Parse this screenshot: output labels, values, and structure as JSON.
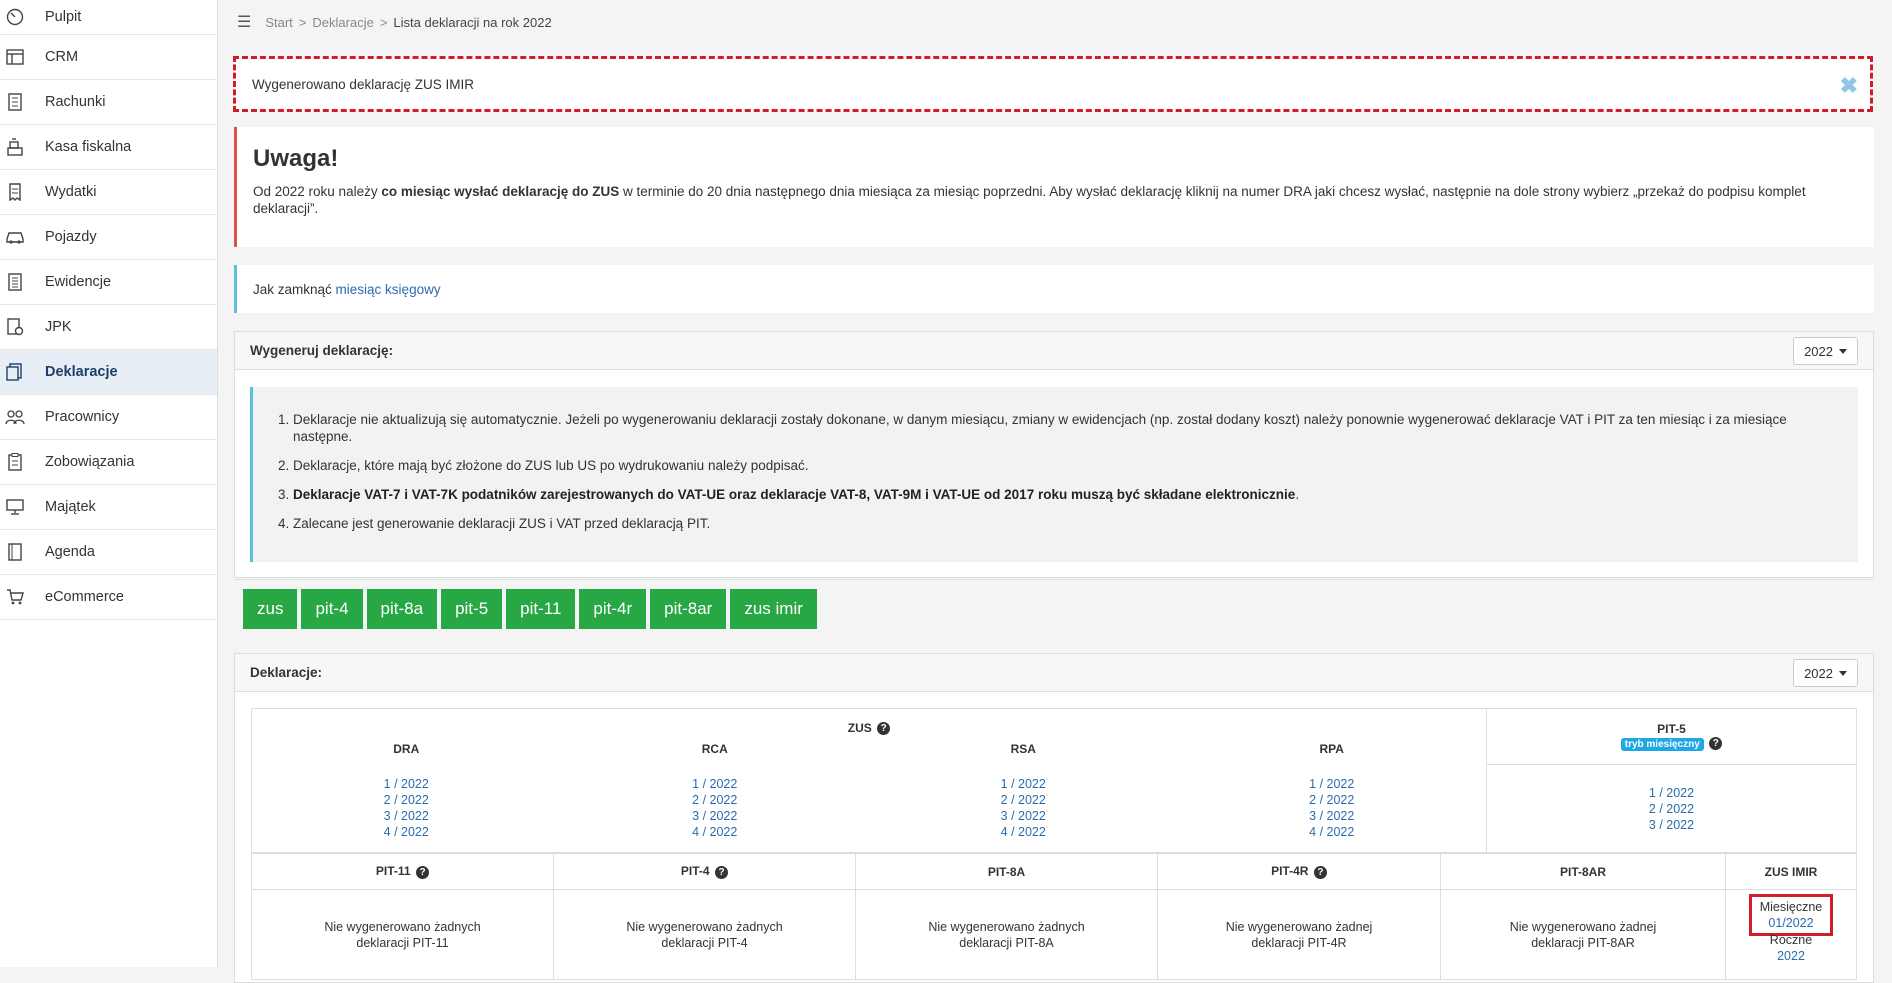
{
  "sidebar": {
    "items": [
      {
        "label": "Pulpit",
        "icon": "gauge-icon"
      },
      {
        "label": "CRM",
        "icon": "crm-window-icon"
      },
      {
        "label": "Rachunki",
        "icon": "invoice-icon"
      },
      {
        "label": "Kasa fiskalna",
        "icon": "cash-register-icon"
      },
      {
        "label": "Wydatki",
        "icon": "expenses-icon"
      },
      {
        "label": "Pojazdy",
        "icon": "car-icon"
      },
      {
        "label": "Ewidencje",
        "icon": "register-book-icon"
      },
      {
        "label": "JPK",
        "icon": "jpk-file-icon"
      },
      {
        "label": "Deklaracje",
        "icon": "declarations-icon"
      },
      {
        "label": "Pracownicy",
        "icon": "employees-icon"
      },
      {
        "label": "Zobowiązania",
        "icon": "obligations-icon"
      },
      {
        "label": "Majątek",
        "icon": "monitor-icon"
      },
      {
        "label": "Agenda",
        "icon": "agenda-icon"
      },
      {
        "label": "eCommerce",
        "icon": "cart-icon"
      }
    ]
  },
  "breadcrumb": {
    "start": "Start",
    "sep": ">",
    "section": "Deklaracje",
    "current": "Lista deklaracji na rok 2022"
  },
  "alert": {
    "text": "Wygenerowano deklarację ZUS IMIR",
    "close": "✖"
  },
  "warning": {
    "title": "Uwaga!",
    "p1": "Od 2022 roku należy ",
    "p_bold": "co miesiąc wysłać deklarację do ZUS",
    "p2": " w terminie do 20 dnia następnego dnia miesiąca za miesiąc poprzedni. Aby wysłać deklarację kliknij na numer DRA jaki chcesz wysłać, następnie na dole strony wybierz „przekaż do podpisu komplet deklaracji”."
  },
  "info": {
    "text": "Jak zamknąć ",
    "link": "miesiąc księgowy"
  },
  "generate": {
    "title": "Wygeneruj deklarację:",
    "year": "2022",
    "notes": [
      "Deklaracje nie aktualizują się automatycznie. Jeżeli po wygenerowaniu deklaracji zostały dokonane, w danym miesiącu, zmiany w ewidencjach (np. został dodany koszt) należy ponownie wygenerować deklaracje VAT i PIT za ten miesiąc i za miesiące następne.",
      "Deklaracje, które mają być złożone do ZUS lub US po wydrukowaniu należy podpisać.",
      "Deklaracje VAT-7 i VAT-7K podatników zarejestrowanych do VAT-UE oraz deklaracje VAT-8, VAT-9M i VAT-UE od 2017 roku muszą być składane elektronicznie",
      "Zalecane jest generowanie deklaracji ZUS i VAT przed deklaracją PIT."
    ],
    "note3_suffix": ".",
    "buttons": [
      "zus",
      "pit-4",
      "pit-8a",
      "pit-5",
      "pit-11",
      "pit-4r",
      "pit-8ar",
      "zus imir"
    ]
  },
  "declarations": {
    "title": "Deklaracje:",
    "year": "2022",
    "zus_label": "ZUS",
    "cols": [
      "DRA",
      "RCA",
      "RSA",
      "RPA"
    ],
    "zus_links": [
      "1 / 2022",
      "2 / 2022",
      "3 / 2022",
      "4 / 2022"
    ],
    "pit5": {
      "label": "PIT-5",
      "badge": "tryb miesięczny",
      "links": [
        "1 / 2022",
        "2 / 2022",
        "3 / 2022"
      ]
    },
    "row2_headers": [
      "PIT-11",
      "PIT-4",
      "PIT-8A",
      "PIT-4R",
      "PIT-8AR",
      "ZUS IMIR"
    ],
    "row2_values": [
      "Nie wygenerowano żadnych deklaracji PIT-11",
      "Nie wygenerowano żadnych deklaracji PIT-4",
      "Nie wygenerowano żadnych deklaracji PIT-8A",
      "Nie wygenerowano żadnej deklaracji PIT-4R",
      "Nie wygenerowano żadnej deklaracji PIT-8AR"
    ],
    "imir": {
      "monthly_label": "Miesięczne",
      "monthly_link": "01/2022",
      "yearly_label": "Roczne",
      "yearly_link": "2022"
    }
  }
}
